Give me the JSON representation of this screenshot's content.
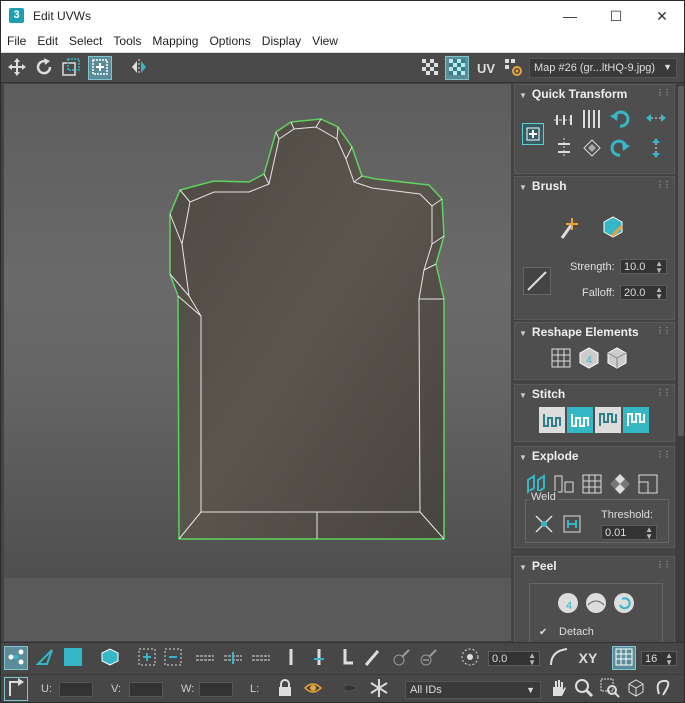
{
  "window": {
    "title": "Edit UVWs",
    "app_badge": "3",
    "minimize": "—",
    "maximize": "☐",
    "close": "✕"
  },
  "menu": [
    "File",
    "Edit",
    "Select",
    "Tools",
    "Mapping",
    "Options",
    "Display",
    "View"
  ],
  "toolbar": {
    "uv_label": "UV",
    "map_name": "Map #26 (gr...ltHQ-9.jpg)",
    "map_arrow": "▼"
  },
  "colors": {
    "accent": "#35b7c6",
    "selected_edge": "#5fd35f",
    "panel_bg": "#444444"
  },
  "panel": {
    "quick_transform": {
      "title": "Quick Transform"
    },
    "brush": {
      "title": "Brush",
      "strength_label": "Strength:",
      "strength_value": "10.0",
      "falloff_label": "Falloff:",
      "falloff_value": "20.0"
    },
    "reshape": {
      "title": "Reshape Elements"
    },
    "stitch": {
      "title": "Stitch"
    },
    "explode": {
      "title": "Explode",
      "weld_label": "Weld",
      "threshold_label": "Threshold:",
      "threshold_value": "0.01"
    },
    "peel": {
      "title": "Peel",
      "detach_check": "✔",
      "detach_label": "Detach"
    }
  },
  "bottom": {
    "rotate_value": "0.0",
    "xy_label": "XY",
    "grid_value": "16",
    "u_label": "U:",
    "v_label": "V:",
    "w_label": "W:",
    "l_label": "L:",
    "ids_value": "All IDs",
    "ids_arrow": "▼"
  }
}
